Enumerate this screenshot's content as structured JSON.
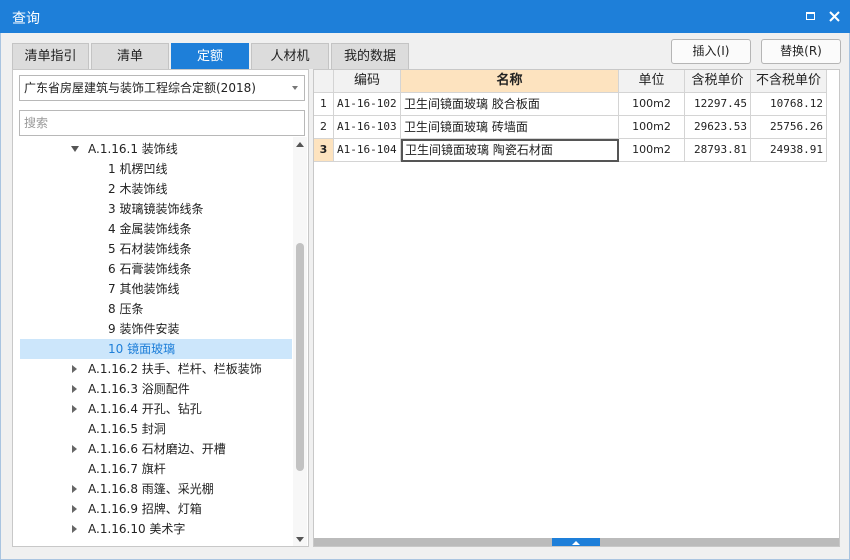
{
  "window": {
    "title": "查询"
  },
  "tabs": [
    "清单指引",
    "清单",
    "定额",
    "人材机",
    "我的数据"
  ],
  "toolbar": {
    "insert_label": "插入(I)",
    "replace_label": "替换(R)"
  },
  "left": {
    "quota_select": "广东省房屋建筑与装饰工程综合定额(2018)",
    "search_placeholder": "搜索",
    "tree": [
      {
        "label": "A.1.16.1 装饰线"
      },
      {
        "label": "1 机楞凹线"
      },
      {
        "label": "2 木装饰线"
      },
      {
        "label": "3 玻璃镜装饰线条"
      },
      {
        "label": "4 金属装饰线条"
      },
      {
        "label": "5 石材装饰线条"
      },
      {
        "label": "6 石膏装饰线条"
      },
      {
        "label": "7 其他装饰线"
      },
      {
        "label": "8 压条"
      },
      {
        "label": "9 装饰件安装"
      },
      {
        "label": "10 镜面玻璃"
      },
      {
        "label": "A.1.16.2 扶手、栏杆、栏板装饰"
      },
      {
        "label": "A.1.16.3 浴厕配件"
      },
      {
        "label": "A.1.16.4 开孔、钻孔"
      },
      {
        "label": "A.1.16.5 封洞"
      },
      {
        "label": "A.1.16.6 石材磨边、开槽"
      },
      {
        "label": "A.1.16.7 旗杆"
      },
      {
        "label": "A.1.16.8 雨篷、采光棚"
      },
      {
        "label": "A.1.16.9 招牌、灯箱"
      },
      {
        "label": "A.1.16.10 美术字"
      }
    ]
  },
  "table": {
    "columns": [
      "编码",
      "名称",
      "单位",
      "含税单价",
      "不含税单价"
    ],
    "rows": [
      {
        "num": "1",
        "code": "A1-16-102",
        "name": "卫生间镜面玻璃 胶合板面",
        "unit": "100m2",
        "price_tax": "12297.45",
        "price_notax": "10768.12"
      },
      {
        "num": "2",
        "code": "A1-16-103",
        "name": "卫生间镜面玻璃 砖墙面",
        "unit": "100m2",
        "price_tax": "29623.53",
        "price_notax": "25756.26"
      },
      {
        "num": "3",
        "code": "A1-16-104",
        "name": "卫生间镜面玻璃 陶瓷石材面",
        "unit": "100m2",
        "price_tax": "28793.81",
        "price_notax": "24938.91"
      }
    ]
  },
  "colors": {
    "accent": "#1e7fd9",
    "header_highlight": "#fde3bf",
    "selected_row": "#cce6fb"
  }
}
